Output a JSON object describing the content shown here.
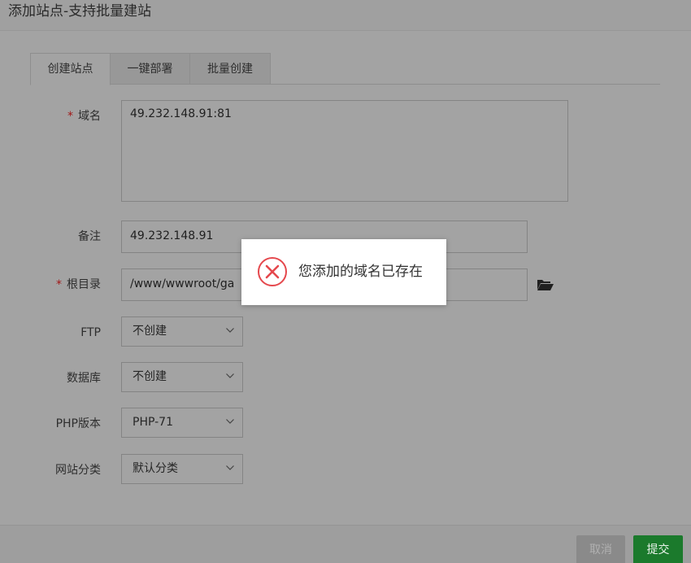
{
  "dialog": {
    "title": "添加站点-支持批量建站",
    "tabs": [
      {
        "label": "创建站点",
        "active": true
      },
      {
        "label": "一键部署",
        "active": false
      },
      {
        "label": "批量创建",
        "active": false
      }
    ]
  },
  "form": {
    "domain": {
      "required": true,
      "required_mark": "*",
      "label": "域名",
      "value": "49.232.148.91:81"
    },
    "remark": {
      "label": "备注",
      "value": "49.232.148.91"
    },
    "root": {
      "required": true,
      "required_mark": "*",
      "label": "根目录",
      "value": "/www/wwwroot/ga"
    },
    "ftp": {
      "label": "FTP",
      "value": "不创建"
    },
    "database": {
      "label": "数据库",
      "value": "不创建"
    },
    "php": {
      "label": "PHP版本",
      "value": "PHP-71"
    },
    "category": {
      "label": "网站分类",
      "value": "默认分类"
    }
  },
  "footer": {
    "cancel_label": "取消",
    "submit_label": "提交"
  },
  "toast": {
    "message": "您添加的域名已存在",
    "icon": "error-circle-icon"
  },
  "colors": {
    "submit": "#1b7a2c",
    "error": "#e5484d",
    "required": "#a21818"
  }
}
